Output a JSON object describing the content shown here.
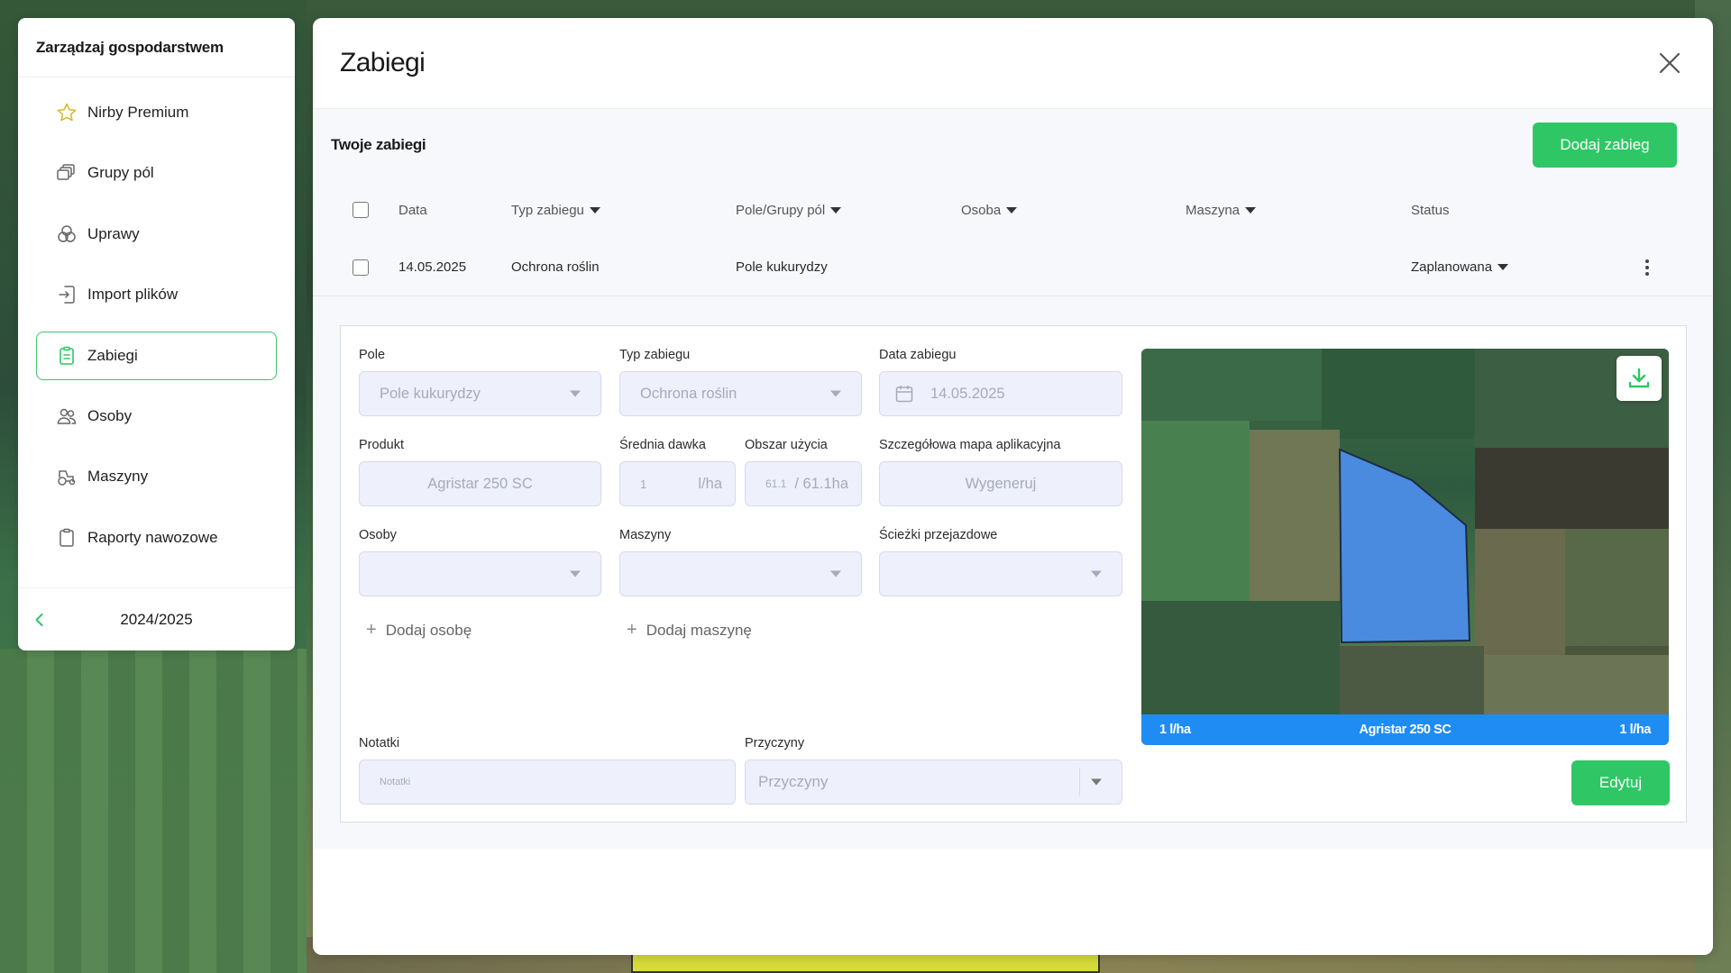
{
  "sidebar": {
    "title": "Zarządzaj gospodarstwem",
    "items": [
      {
        "label": "Nirby Premium",
        "icon": "star-icon"
      },
      {
        "label": "Grupy pól",
        "icon": "layers-icon"
      },
      {
        "label": "Uprawy",
        "icon": "crops-icon"
      },
      {
        "label": "Import plików",
        "icon": "import-icon"
      },
      {
        "label": "Zabiegi",
        "icon": "clipboard-icon",
        "active": true
      },
      {
        "label": "Osoby",
        "icon": "people-icon"
      },
      {
        "label": "Maszyny",
        "icon": "tractor-icon"
      },
      {
        "label": "Raporty nawozowe",
        "icon": "report-icon"
      }
    ],
    "season": "2024/2025"
  },
  "panel": {
    "title": "Zabiegi",
    "section_label": "Twoje zabiegi",
    "add_button": "Dodaj zabieg",
    "table": {
      "headers": {
        "date": "Data",
        "type": "Typ zabiegu",
        "field": "Pole/Grupy pól",
        "person": "Osoba",
        "machine": "Maszyna",
        "status": "Status"
      },
      "rows": [
        {
          "date": "14.05.2025",
          "type": "Ochrona roślin",
          "field": "Pole kukurydzy",
          "person": "",
          "machine": "",
          "status": "Zaplanowana"
        }
      ]
    },
    "form": {
      "field_label": "Pole",
      "field_value": "Pole kukurydzy",
      "type_label": "Typ zabiegu",
      "type_value": "Ochrona roślin",
      "date_label": "Data zabiegu",
      "date_value": "14.05.2025",
      "product_label": "Produkt",
      "product_value": "Agristar 250 SC",
      "dose_label": "Średnia dawka",
      "dose_value": "1",
      "dose_unit": "l/ha",
      "area_label": "Obszar użycia",
      "area_value": "61.1",
      "area_total": "/ 61.1ha",
      "map_label": "Szczegółowa mapa aplikacyjna",
      "map_button": "Wygeneruj",
      "persons_label": "Osoby",
      "machines_label": "Maszyny",
      "tracks_label": "Ścieżki przejazdowe",
      "add_person": "Dodaj osobę",
      "add_machine": "Dodaj maszynę",
      "notes_label": "Notatki",
      "notes_placeholder": "Notatki",
      "reasons_label": "Przyczyny",
      "reasons_placeholder": "Przyczyny",
      "edit_button": "Edytuj"
    },
    "map_legend": {
      "left": "1 l/ha",
      "center": "Agristar 250 SC",
      "right": "1 l/ha"
    }
  },
  "colors": {
    "accent": "#2fc765",
    "field_fill": "#4a8be0",
    "legend_bar": "#1f8cf3"
  }
}
